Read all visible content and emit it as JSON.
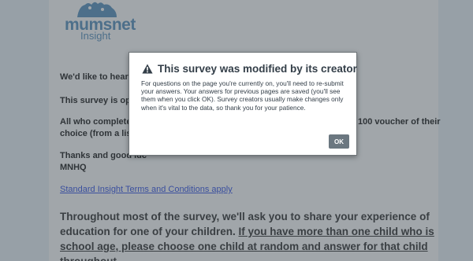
{
  "logo": {
    "wordmark": "mumsnet",
    "subtitle": "Insight",
    "color": "#4d6f8a"
  },
  "page": {
    "paragraphs": [
      "We'd like to hear you",
      "This survey is open",
      "All who complete th",
      "100 voucher of their",
      "choice (from a list).",
      "Thanks and good luc",
      "MNHQ"
    ],
    "terms_link": "Standard Insight Terms and Conditions apply",
    "instruction_plain": "Throughout most of the survey, we'll ask you to share your experience of education for one of your children. ",
    "instruction_underlined": "If you have more than one child who is school age, please choose one child at random and answer for that child throughout."
  },
  "modal": {
    "icon": "warning-icon",
    "title": "This survey was modified by its creator",
    "body": "For questions on the page you're currently on, you'll need to re-submit your answers. Your answers for previous pages are saved (you'll see them when you click OK). Survey creators usually make changes only when it's vital to the data, so thank you for your patience.",
    "ok_label": "OK",
    "ok_color": "#6b7780"
  }
}
